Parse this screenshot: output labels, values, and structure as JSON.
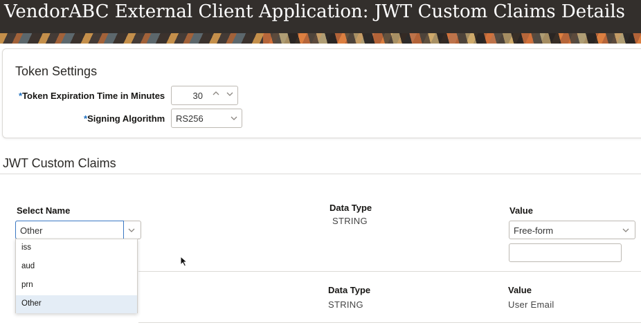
{
  "header": {
    "title": "VendorABC External Client Application: JWT Custom Claims Details"
  },
  "token_settings": {
    "title": "Token Settings",
    "expiration": {
      "label": "Token Expiration Time in Minutes",
      "value": "30"
    },
    "algorithm": {
      "label": "Signing Algorithm",
      "value": "RS256"
    },
    "required_marker": "*"
  },
  "claims": {
    "title": "JWT Custom Claims",
    "row1": {
      "select_name_label": "Select Name",
      "select_name_value": "Other",
      "data_type_label": "Data Type",
      "data_type_value": "STRING",
      "value_label": "Value",
      "value_select": "Free-form",
      "value_input": ""
    },
    "dropdown_options": [
      "iss",
      "aud",
      "prn",
      "Other"
    ],
    "row2": {
      "data_type_label": "Data Type",
      "data_type_value": "STRING",
      "value_label": "Value",
      "value_value": "User Email"
    }
  },
  "icons": {
    "up": "chevron-up-icon",
    "down": "chevron-down-icon",
    "cursor": "mouse-pointer-icon"
  }
}
